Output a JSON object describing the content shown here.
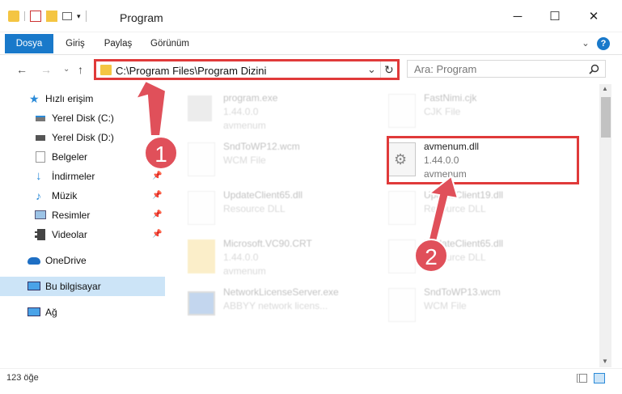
{
  "window": {
    "title": "Program",
    "minimize": "─",
    "maximize": "☐",
    "close": "✕"
  },
  "ribbon": {
    "tabs": [
      "Dosya",
      "Giriş",
      "Paylaş",
      "Görünüm"
    ],
    "collapse": "⌄",
    "help": "?"
  },
  "address": {
    "path": "C:\\Program Files\\Program Dizini",
    "back": "←",
    "forward": "→",
    "history": "⌄",
    "up": "↑",
    "refresh": "↻",
    "dropdown": "⌄"
  },
  "search": {
    "placeholder": "Ara: Program"
  },
  "nav": {
    "items": [
      {
        "label": "Hızlı erişim",
        "icon": "star-icon"
      },
      {
        "label": "Yerel Disk (C:)",
        "icon": "drive-icon"
      },
      {
        "label": "Yerel Disk (D:)",
        "icon": "drive-icon"
      },
      {
        "label": "Belgeler",
        "icon": "documents-icon"
      },
      {
        "label": "İndirmeler",
        "icon": "download-icon"
      },
      {
        "label": "Müzik",
        "icon": "music-icon"
      },
      {
        "label": "Resimler",
        "icon": "pictures-icon"
      },
      {
        "label": "Videolar",
        "icon": "video-icon"
      },
      {
        "label": "OneDrive",
        "icon": "cloud-icon"
      },
      {
        "label": "Bu bilgisayar",
        "icon": "computer-icon"
      },
      {
        "label": "Ağ",
        "icon": "network-icon"
      }
    ]
  },
  "files": [
    {
      "name": "program.exe",
      "line2": "1.44.0.0",
      "line3": "avmenum"
    },
    {
      "name": "FastNimi.cjk",
      "line2": "CJK File",
      "line3": ""
    },
    {
      "name": "SndToWP12.wcm",
      "line2": "WCM File",
      "line3": ""
    },
    {
      "name": "avmenum.dll",
      "line2": "1.44.0.0",
      "line3": "avmenum"
    },
    {
      "name": "UpdateClient65.dll",
      "line2": "Resource DLL",
      "line3": ""
    },
    {
      "name": "UpdateClient19.dll",
      "line2": "Resource DLL",
      "line3": ""
    },
    {
      "name": "Microsoft.VC90.CRT",
      "line2": "1.44.0.0",
      "line3": "avmenum"
    },
    {
      "name": "UpdateClient65.dll",
      "line2": "Resource DLL",
      "line3": ""
    },
    {
      "name": "NetworkLicenseServer.exe",
      "line2": "ABBYY network licens...",
      "line3": ""
    },
    {
      "name": "SndToWP13.wcm",
      "line2": "WCM File",
      "line3": ""
    }
  ],
  "annotations": {
    "step1": "1",
    "step2": "2"
  },
  "status": {
    "count": "123 öğe"
  },
  "colors": {
    "accent": "#1979ca",
    "highlight": "#e03a3a",
    "selection": "#cce4f7"
  }
}
